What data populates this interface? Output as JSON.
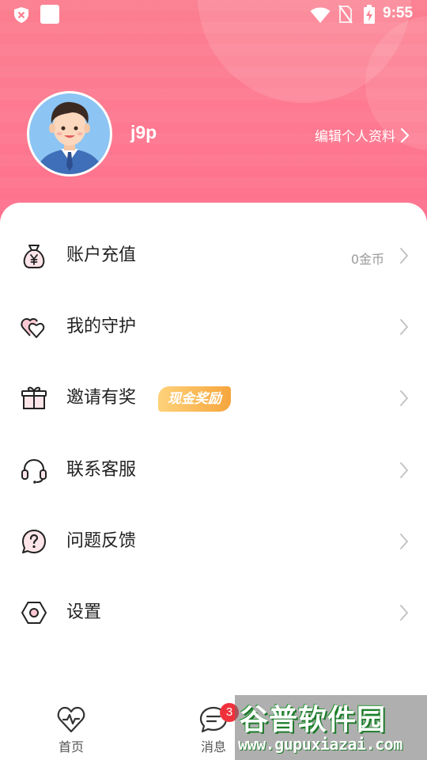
{
  "status_bar": {
    "time": "9:55",
    "icons": [
      "shield-x-icon",
      "square-icon",
      "wifi-icon",
      "no-sim-icon",
      "battery-charging-icon"
    ]
  },
  "profile": {
    "username": "j9p",
    "edit_label": "编辑个人资料",
    "avatar_icon": "male-avatar-icon"
  },
  "menu": {
    "items": [
      {
        "icon": "money-bag-icon",
        "label": "账户充值",
        "value": "0金币"
      },
      {
        "icon": "heart-shield-icon",
        "label": "我的守护"
      },
      {
        "icon": "gift-icon",
        "label": "邀请有奖",
        "badge": "现金奖励"
      },
      {
        "icon": "headset-icon",
        "label": "联系客服"
      },
      {
        "icon": "question-bubble-icon",
        "label": "问题反馈"
      },
      {
        "icon": "settings-hex-icon",
        "label": "设置"
      }
    ]
  },
  "tabbar": {
    "tabs": [
      {
        "icon": "heart-pulse-icon",
        "label": "首页"
      },
      {
        "icon": "chat-bubble-icon",
        "label": "消息",
        "badge": "3"
      }
    ]
  },
  "watermark": {
    "logo": "谷普软件园",
    "url": "www.gupuxiazai.com"
  },
  "colors": {
    "header_top": "#fb7e8f",
    "header_bottom": "#fe6f8d",
    "accent_pink": "#fd8aa0",
    "badge_red": "#f0313c",
    "reward_gradient_start": "#ffd27a",
    "reward_gradient_end": "#f6a63d"
  }
}
